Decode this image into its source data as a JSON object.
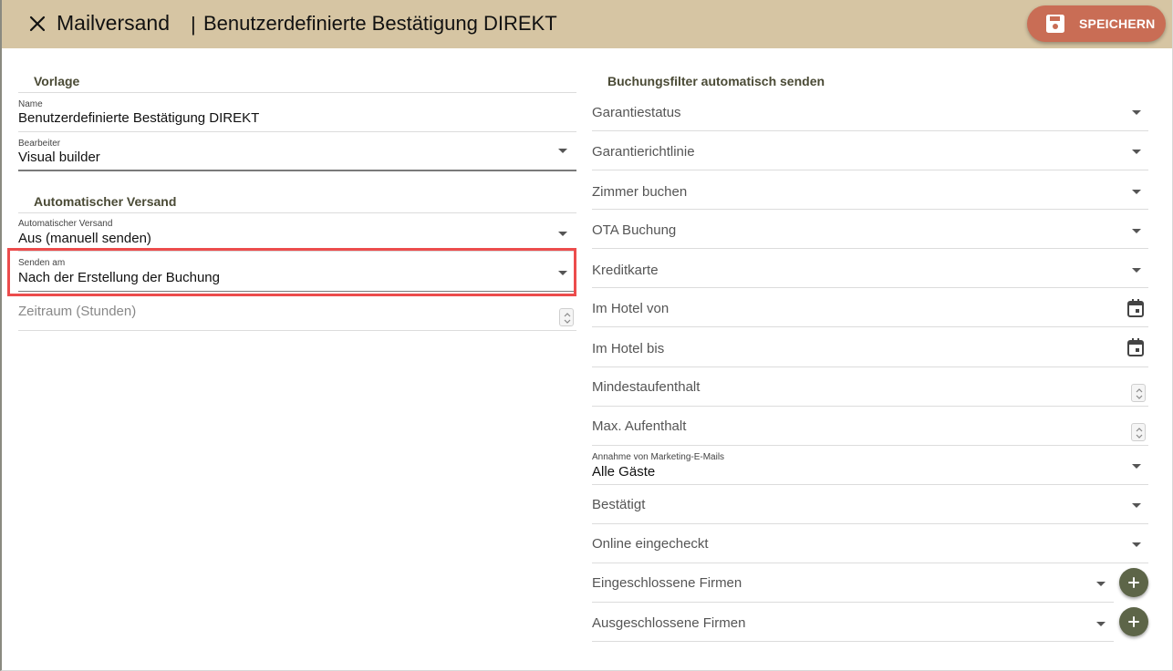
{
  "header": {
    "title": "Mailversand",
    "separator": "|",
    "subtitle": "Benutzerdefinierte Bestätigung DIREKT",
    "save_label": "SPEICHERN",
    "close_icon": "close-icon",
    "save_icon": "floppy-disk-icon"
  },
  "colors": {
    "header_bg": "#d6c5a3",
    "save_button": "#c96d55",
    "section_heading": "#4a4a35",
    "add_button": "#5d6548",
    "highlight": "#ec4c4c"
  },
  "left": {
    "vorlage_heading": "Vorlage",
    "name_label": "Name",
    "name_value": "Benutzerdefinierte Bestätigung DIREKT",
    "bearbeiter_label": "Bearbeiter",
    "bearbeiter_value": "Visual builder",
    "auto_heading": "Automatischer Versand",
    "auto_label": "Automatischer Versand",
    "auto_value": "Aus (manuell senden)",
    "senden_label": "Senden am",
    "senden_value": "Nach der Erstellung der Buchung",
    "zeitraum_placeholder": "Zeitraum (Stunden)"
  },
  "right": {
    "heading": "Buchungsfilter automatisch senden",
    "garantiestatus": "Garantiestatus",
    "garantierichtlinie": "Garantierichtlinie",
    "zimmer": "Zimmer buchen",
    "ota": "OTA Buchung",
    "kreditkarte": "Kreditkarte",
    "hotel_von": "Im Hotel von",
    "hotel_bis": "Im Hotel bis",
    "mindest": "Mindestaufenthalt",
    "max": "Max. Aufenthalt",
    "marketing_label": "Annahme von Marketing-E-Mails",
    "marketing_value": "Alle Gäste",
    "bestaetigt": "Bestätigt",
    "online": "Online eingecheckt",
    "eingeschlossene": "Eingeschlossene Firmen",
    "ausgeschlossene": "Ausgeschlossene Firmen"
  }
}
